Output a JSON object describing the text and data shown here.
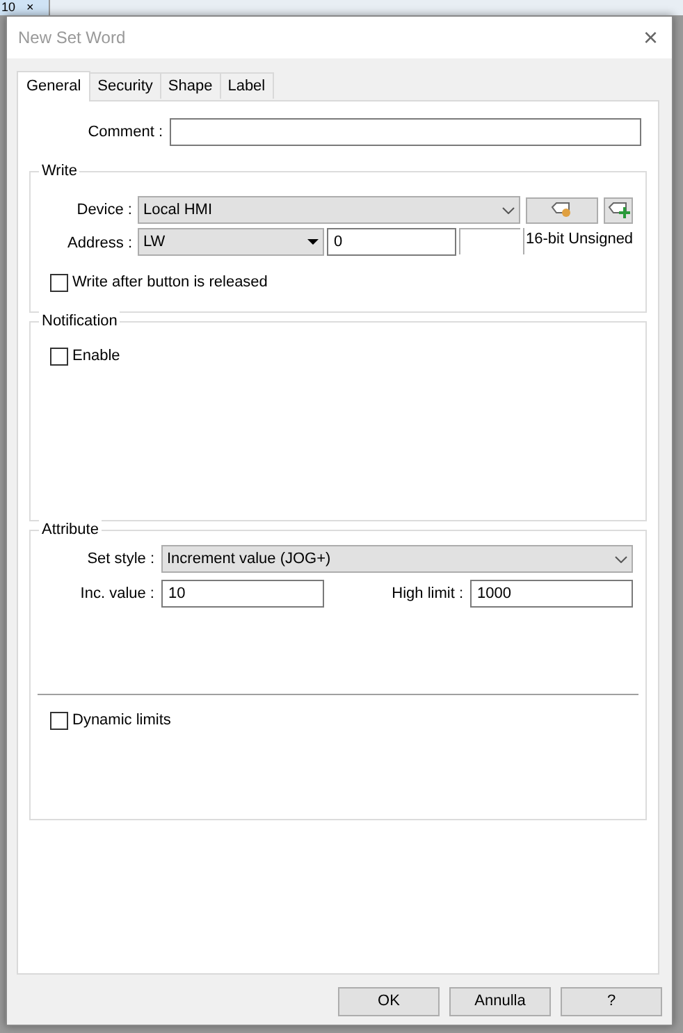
{
  "background_tab": {
    "label": "10",
    "close": "×"
  },
  "window": {
    "title": "New Set Word",
    "close": "×"
  },
  "tabs": [
    {
      "label": "General",
      "selected": true
    },
    {
      "label": "Security",
      "selected": false
    },
    {
      "label": "Shape",
      "selected": false
    },
    {
      "label": "Label",
      "selected": false
    }
  ],
  "comment": {
    "label": "Comment :"
  },
  "write": {
    "title": "Write",
    "device_label": "Device :",
    "device": "Local HMI",
    "address_label": "Address :",
    "address_type": "LW",
    "address": "0",
    "data_format": "16-bit Unsigned",
    "write_after_release": {
      "label": "Write after button is released",
      "checked": false
    }
  },
  "notification": {
    "title": "Notification",
    "enable": {
      "label": "Enable",
      "checked": false
    }
  },
  "attribute": {
    "title": "Attribute",
    "set_style_label": "Set style :",
    "set_style": "Increment value (JOG+)",
    "inc_label": "Inc. value :",
    "inc_value": "10",
    "high_label": "High limit :",
    "high_value": "1000",
    "dynamic_limits": {
      "label": "Dynamic limits",
      "checked": false
    }
  },
  "buttons": [
    "OK",
    "Annulla",
    "?"
  ]
}
